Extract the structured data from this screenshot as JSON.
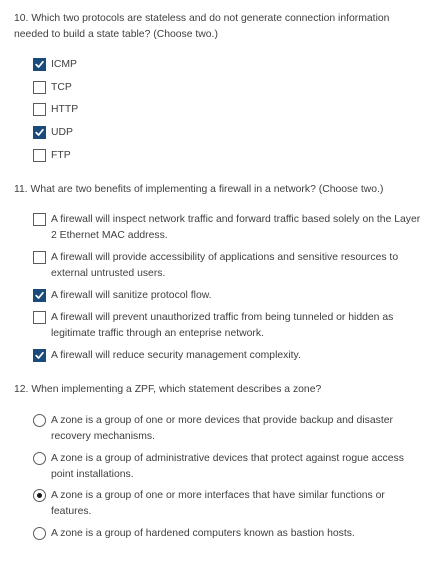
{
  "questions": [
    {
      "text": "10. Which two protocols are stateless and do not generate connection information needed to build a state table? (Choose two.)",
      "type": "checkbox",
      "options": [
        {
          "label": "ICMP",
          "selected": true
        },
        {
          "label": "TCP",
          "selected": false
        },
        {
          "label": "HTTP",
          "selected": false
        },
        {
          "label": "UDP",
          "selected": true
        },
        {
          "label": "FTP",
          "selected": false
        }
      ]
    },
    {
      "text": "11. What are two benefits of implementing a firewall in a network? (Choose two.)",
      "type": "checkbox",
      "options": [
        {
          "label": "A firewall will inspect network traffic and forward traffic based solely on the Layer 2 Ethernet MAC address.",
          "selected": false
        },
        {
          "label": "A firewall will provide accessibility of applications and sensitive resources to external untrusted users.",
          "selected": false
        },
        {
          "label": "A firewall will sanitize protocol flow.",
          "selected": true
        },
        {
          "label": "A firewall will prevent unauthorized traffic from being tunneled or hidden as legitimate traffic through an enteprise network.",
          "selected": false
        },
        {
          "label": "A firewall will reduce security management complexity.",
          "selected": true
        }
      ]
    },
    {
      "text": "12. When implementing a ZPF, which statement describes a zone?",
      "type": "radio",
      "options": [
        {
          "label": "A zone is a group of one or more devices that provide backup and disaster recovery mechanisms.",
          "selected": false
        },
        {
          "label": "A zone is a group of administrative devices that protect against rogue access point installations.",
          "selected": false
        },
        {
          "label": "A zone is a group of one or more interfaces that have similar functions or features.",
          "selected": true
        },
        {
          "label": "A zone is a group of hardened computers known as bastion hosts.",
          "selected": false
        }
      ]
    }
  ]
}
